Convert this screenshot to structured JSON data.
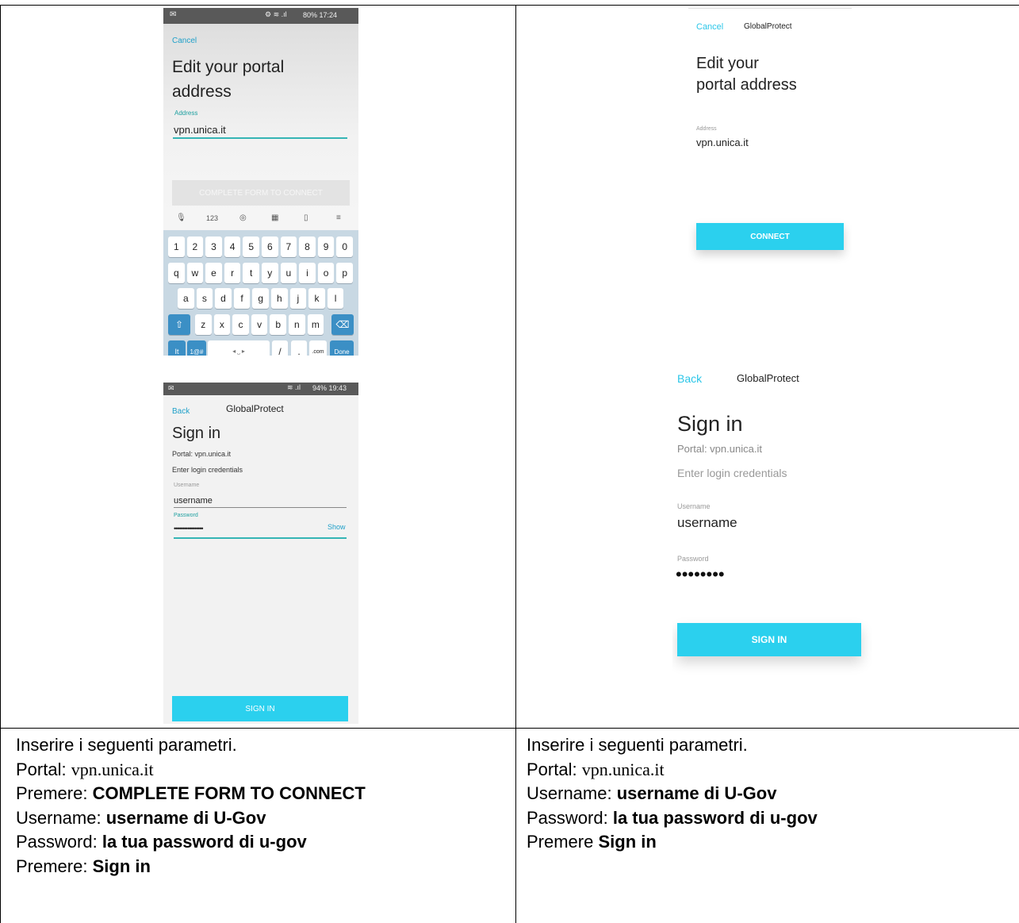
{
  "left_top": {
    "android_edit": {
      "status_bar": "80% 17:24",
      "cancel": "Cancel",
      "title_line1": "Edit your portal",
      "title_line2": "address",
      "address_label": "Address",
      "address_value": "vpn.unica.it",
      "complete_button": "COMPLETE FORM TO CONNECT",
      "kb_toolbar": [
        "123"
      ],
      "kb_row1": [
        "1",
        "2",
        "3",
        "4",
        "5",
        "6",
        "7",
        "8",
        "9",
        "0"
      ],
      "kb_row2": [
        "q",
        "w",
        "e",
        "r",
        "t",
        "y",
        "u",
        "i",
        "o",
        "p"
      ],
      "kb_row3": [
        "a",
        "s",
        "d",
        "f",
        "g",
        "h",
        "j",
        "k",
        "l"
      ],
      "kb_row4": [
        "z",
        "x",
        "c",
        "v",
        "b",
        "n",
        "m"
      ],
      "kb_row5": [
        "It",
        "1@#",
        "/",
        ".",
        ".com",
        "Done"
      ]
    },
    "android_signin": {
      "status_bar": "94% 19:43",
      "back": "Back",
      "app_title": "GlobalProtect",
      "title": "Sign in",
      "portal": "Portal:  vpn.unica.it",
      "enter_credentials": "Enter login credentials",
      "username_label": "Username",
      "username_value": "username",
      "password_label": "Password",
      "password_value": "•••••••••••••••••",
      "show": "Show",
      "signin_button": "SIGN IN"
    }
  },
  "right_top": {
    "ios_edit": {
      "cancel": "Cancel",
      "app_title": "GlobalProtect",
      "title_line1": "Edit your",
      "title_line2": "portal address",
      "address_label": "Address",
      "address_value": "vpn.unica.it",
      "connect_button": "CONNECT"
    },
    "ios_signin": {
      "back": "Back",
      "app_title": "GlobalProtect",
      "title": "Sign in",
      "portal": "Portal: vpn.unica.it",
      "enter_credentials": "Enter login credentials",
      "username_label": "Username",
      "username_value": "username",
      "password_label": "Password",
      "password_value": "••••••••",
      "signin_button": "SIGN IN"
    }
  },
  "left_bottom": {
    "line1": "Inserire i seguenti parametri.",
    "portal_label": "Portal: ",
    "portal_value": "vpn.unica.it",
    "press1_label": "Premere: ",
    "press1_value": "COMPLETE FORM TO CONNECT",
    "username_label": "Username: ",
    "username_value": "username di U-Gov",
    "password_label": "Password: ",
    "password_value": "la tua password di u-gov",
    "press2_label": "Premere: ",
    "press2_value": "Sign in"
  },
  "right_bottom": {
    "line1": "Inserire i seguenti parametri.",
    "portal_label": "Portal: ",
    "portal_value": "vpn.unica.it",
    "username_label": "Username: ",
    "username_value": "username di U-Gov",
    "password_label": "Password: ",
    "password_value": "la tua password di u-gov",
    "press_label": "Premere ",
    "press_value": "Sign in"
  }
}
